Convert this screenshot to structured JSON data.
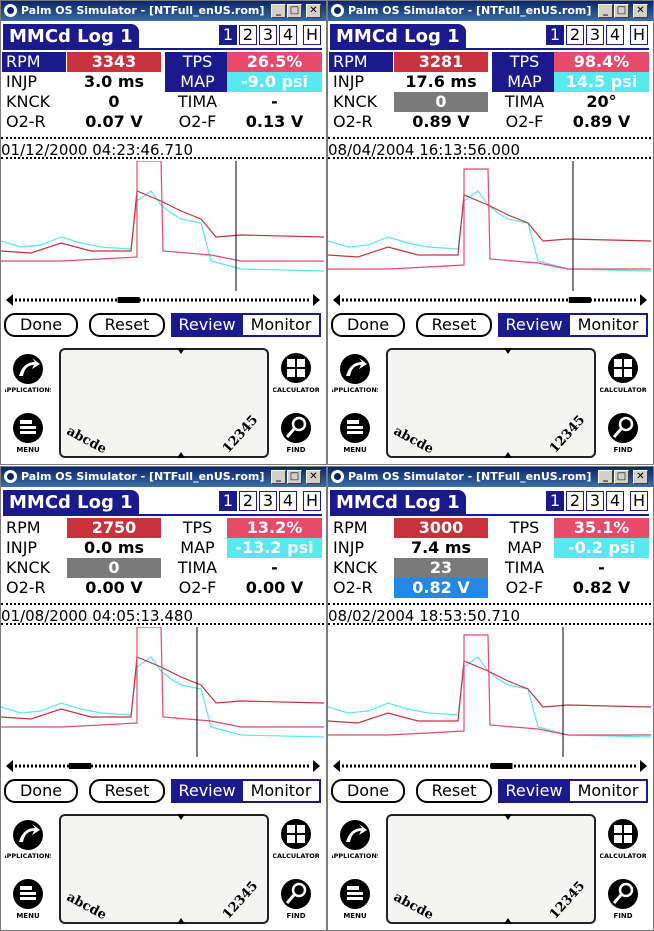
{
  "window_title": "Palm OS Simulator - [NTFull_enUS.rom]",
  "app_title": "MMCd Log 1",
  "log_tabs": [
    "1",
    "2",
    "3",
    "4",
    "H"
  ],
  "labels": {
    "rpm": "RPM",
    "tps": "TPS",
    "injp": "INJP",
    "map": "MAP",
    "knck": "KNCK",
    "tima": "TIMA",
    "o2r": "O2-R",
    "o2f": "O2-F"
  },
  "buttons": {
    "done": "Done",
    "reset": "Reset",
    "review": "Review",
    "monitor": "Monitor"
  },
  "silk": {
    "applications": "APPLICATIONS",
    "calculator": "CALCULATOR",
    "menu": "MENU",
    "find": "FIND",
    "letters": "abcde",
    "numbers": "12345"
  },
  "colors": {
    "rpm": "#c8323c",
    "tps": "#e84a6a",
    "map": "#58e8f0",
    "knck": "#7a7a7a",
    "o2r": "#2288e8",
    "select": "#1a1a8c"
  },
  "panels": [
    {
      "rpm": "3343",
      "tps": "26.5%",
      "injp": "3.0 ms",
      "map": "-9.0 psi",
      "knck": "0",
      "tima": "-",
      "o2r": "0.07 V",
      "o2f": "0.13 V",
      "datetime": "01/12/2000    04:23:46.710",
      "labels_hl": {
        "rpm": true,
        "tps": true,
        "map": true
      },
      "knck_hl": false,
      "o2r_hl": false,
      "scroll_pos": 0.38
    },
    {
      "rpm": "3281",
      "tps": "98.4%",
      "injp": "17.6 ms",
      "map": "14.5 psi",
      "knck": "0",
      "tima": "20°",
      "o2r": "0.89 V",
      "o2f": "0.89 V",
      "datetime": "08/04/2004    16:13:56.000",
      "labels_hl": {
        "rpm": true,
        "tps": true,
        "map": true
      },
      "knck_hl": true,
      "o2r_hl": false,
      "scroll_pos": 0.84
    },
    {
      "rpm": "2750",
      "tps": "13.2%",
      "injp": "0.0 ms",
      "map": "-13.2 psi",
      "knck": "0",
      "tima": "-",
      "o2r": "0.00 V",
      "o2f": "0.00 V",
      "datetime": "01/08/2000    04:05:13.480",
      "labels_hl": {
        "rpm": false,
        "tps": false,
        "map": false
      },
      "knck_hl": true,
      "o2r_hl": false,
      "scroll_pos": 0.2
    },
    {
      "rpm": "3000",
      "tps": "35.1%",
      "injp": "7.4 ms",
      "map": "-0.2 psi",
      "knck": "23",
      "tima": "-",
      "o2r": "0.82 V",
      "o2f": "0.82 V",
      "datetime": "08/02/2004    18:53:50.710",
      "labels_hl": {
        "rpm": false,
        "tps": false,
        "map": false
      },
      "knck_hl": true,
      "o2r_hl": true,
      "scroll_pos": 0.55
    }
  ]
}
